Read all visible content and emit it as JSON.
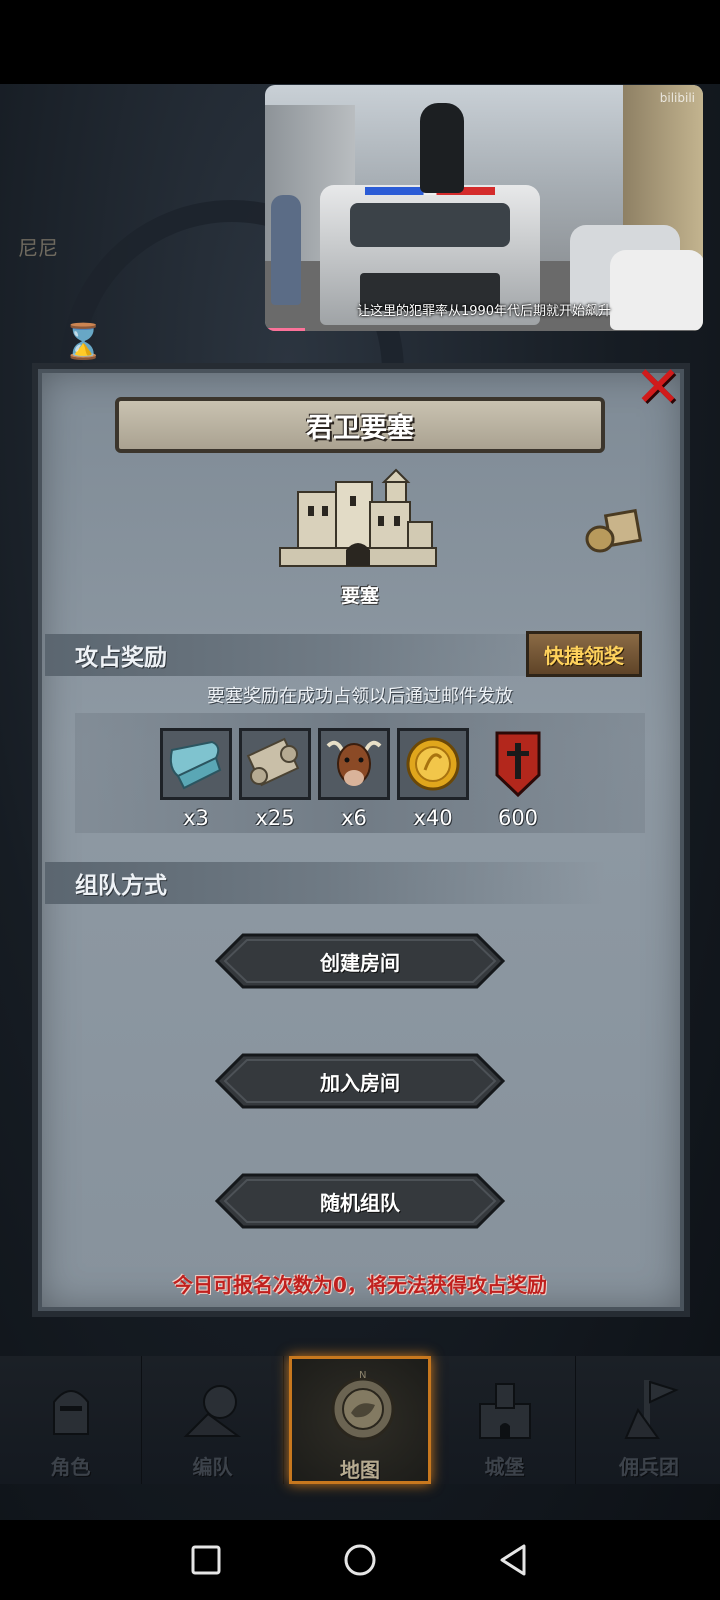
{
  "video": {
    "watermark": "bilibili",
    "subtitle": "让这里的犯罪率从1990年代后期就开始飙升"
  },
  "background": {
    "partial_text": "尼尼"
  },
  "panel": {
    "title": "君卫要塞",
    "building_label": "要塞",
    "close_icon": "close-x-icon",
    "bag_icon": "supply-bag-icon"
  },
  "rewards": {
    "header": "攻占奖励",
    "quick_claim_label": "快捷领奖",
    "note": "要塞奖励在成功占领以后通过邮件发放",
    "items": [
      {
        "icon": "cloth-icon",
        "qty": "x3"
      },
      {
        "icon": "scroll-icon",
        "qty": "x25"
      },
      {
        "icon": "cattle-icon",
        "qty": "x6"
      },
      {
        "icon": "gold-coin-icon",
        "qty": "x40"
      },
      {
        "icon": "banner-emblem-icon",
        "qty": "600"
      }
    ]
  },
  "team": {
    "header": "组队方式",
    "create_room_label": "创建房间",
    "join_room_label": "加入房间",
    "random_team_label": "随机组队",
    "warning": "今日可报名次数为0，将无法获得攻占奖励"
  },
  "bottom_nav": {
    "tabs": [
      {
        "label": "角色",
        "icon": "knight-helmet-icon"
      },
      {
        "label": "编队",
        "icon": "formation-icon"
      },
      {
        "label": "地图",
        "icon": "compass-map-icon",
        "active": true
      },
      {
        "label": "城堡",
        "icon": "castle-icon"
      },
      {
        "label": "佣兵团",
        "icon": "mercenary-icon"
      }
    ]
  },
  "colors": {
    "accent_orange": "#c8781e",
    "warning_red": "#c0201e",
    "quick_claim_text": "#ffd25c",
    "close_red": "#d11b1b"
  }
}
